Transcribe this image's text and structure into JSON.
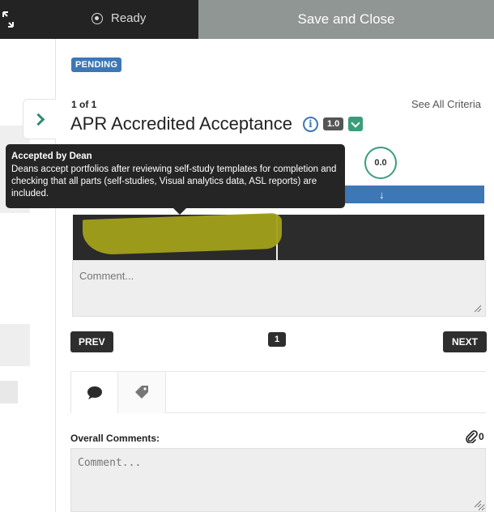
{
  "toolbar": {
    "status_label": "Ready",
    "save_close_label": "Save and Close"
  },
  "criterion": {
    "status_badge": "PENDING",
    "counter": "1 of 1",
    "see_all_label": "See All Criteria",
    "title": "APR Accredited Acceptance",
    "info_glyph": "i",
    "weight": "1.0",
    "score": "0.0",
    "arrow_glyph": "↓"
  },
  "tooltip": {
    "title": "Accepted by Dean",
    "body": "Deans accept portfolios after reviewing self-study templates for completion and checking that all parts (self-studies, Visual analytics data, ASL reports) are included."
  },
  "comment": {
    "placeholder": "Comment..."
  },
  "pagination": {
    "prev_label": "PREV",
    "current_page": "1",
    "next_label": "NEXT"
  },
  "tabs": [
    {
      "icon": "comment-icon"
    },
    {
      "icon": "tag-icon"
    }
  ],
  "overall": {
    "label": "Overall Comments:",
    "attachment_count": "0",
    "placeholder": "Comment..."
  },
  "colors": {
    "accent_blue": "#3d77b6",
    "accent_green": "#3a9d7a",
    "dark": "#232323",
    "save_bar": "#8f9694",
    "highlight": "#a2a01a"
  }
}
